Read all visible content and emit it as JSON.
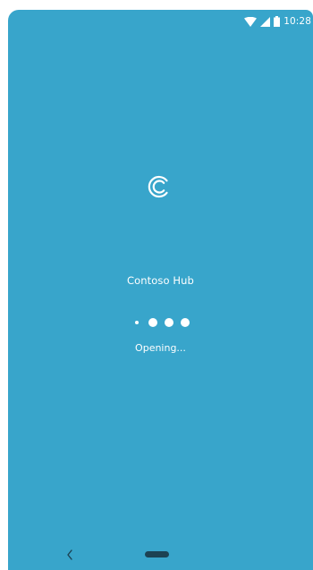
{
  "status_bar": {
    "time": "10:28",
    "icons": [
      "wifi-icon",
      "cellular-signal-icon",
      "battery-icon"
    ]
  },
  "splash": {
    "logo_icon": "contoso-c-logo-icon",
    "app_name": "Contoso Hub",
    "status_text": "Opening...",
    "loading_dots_count": 4,
    "background_color": "#38a5cb",
    "foreground_color": "#ffffff"
  },
  "nav_bar": {
    "back_icon": "chevron-left-icon",
    "home_icon": "home-pill-icon"
  }
}
